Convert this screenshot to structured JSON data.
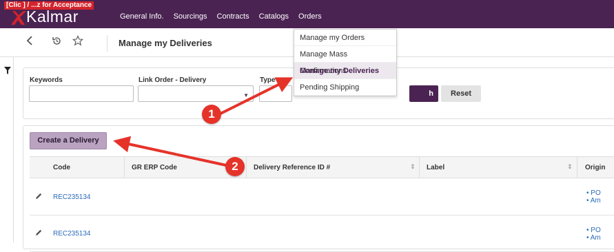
{
  "app": {
    "logo_tag": "[Clic   ] / ...z for Acceptance",
    "logo_word": "Kalmar"
  },
  "nav": {
    "items": [
      "General Info.",
      "Sourcings",
      "Contracts",
      "Catalogs",
      "Orders"
    ]
  },
  "subbar": {
    "title": "Manage my Deliveries"
  },
  "dropdown": {
    "items": [
      "Manage my Orders",
      "Manage Mass Confirmations",
      "Manage my Deliveries",
      "Pending Shipping"
    ],
    "active_index": 2
  },
  "filters": {
    "keywords_label": "Keywords",
    "link_label": "Link Order - Delivery",
    "type_label": "Type",
    "search_label": "h",
    "reset_label": "Reset"
  },
  "results": {
    "create_label": "Create a Delivery",
    "columns": [
      "Code",
      "GR ERP Code",
      "Delivery Reference ID #",
      "Label",
      "Origin"
    ],
    "rows": [
      {
        "code": "REC235134",
        "origin": [
          "• PO",
          "• Am"
        ]
      },
      {
        "code": "REC235134",
        "origin": [
          "• PO",
          "• Am"
        ]
      }
    ]
  },
  "annotations": {
    "badge1": "1",
    "badge2": "2"
  },
  "colors": {
    "brand": "#4a2352",
    "link": "#2a6ab8",
    "annotation": "#e5332a"
  }
}
